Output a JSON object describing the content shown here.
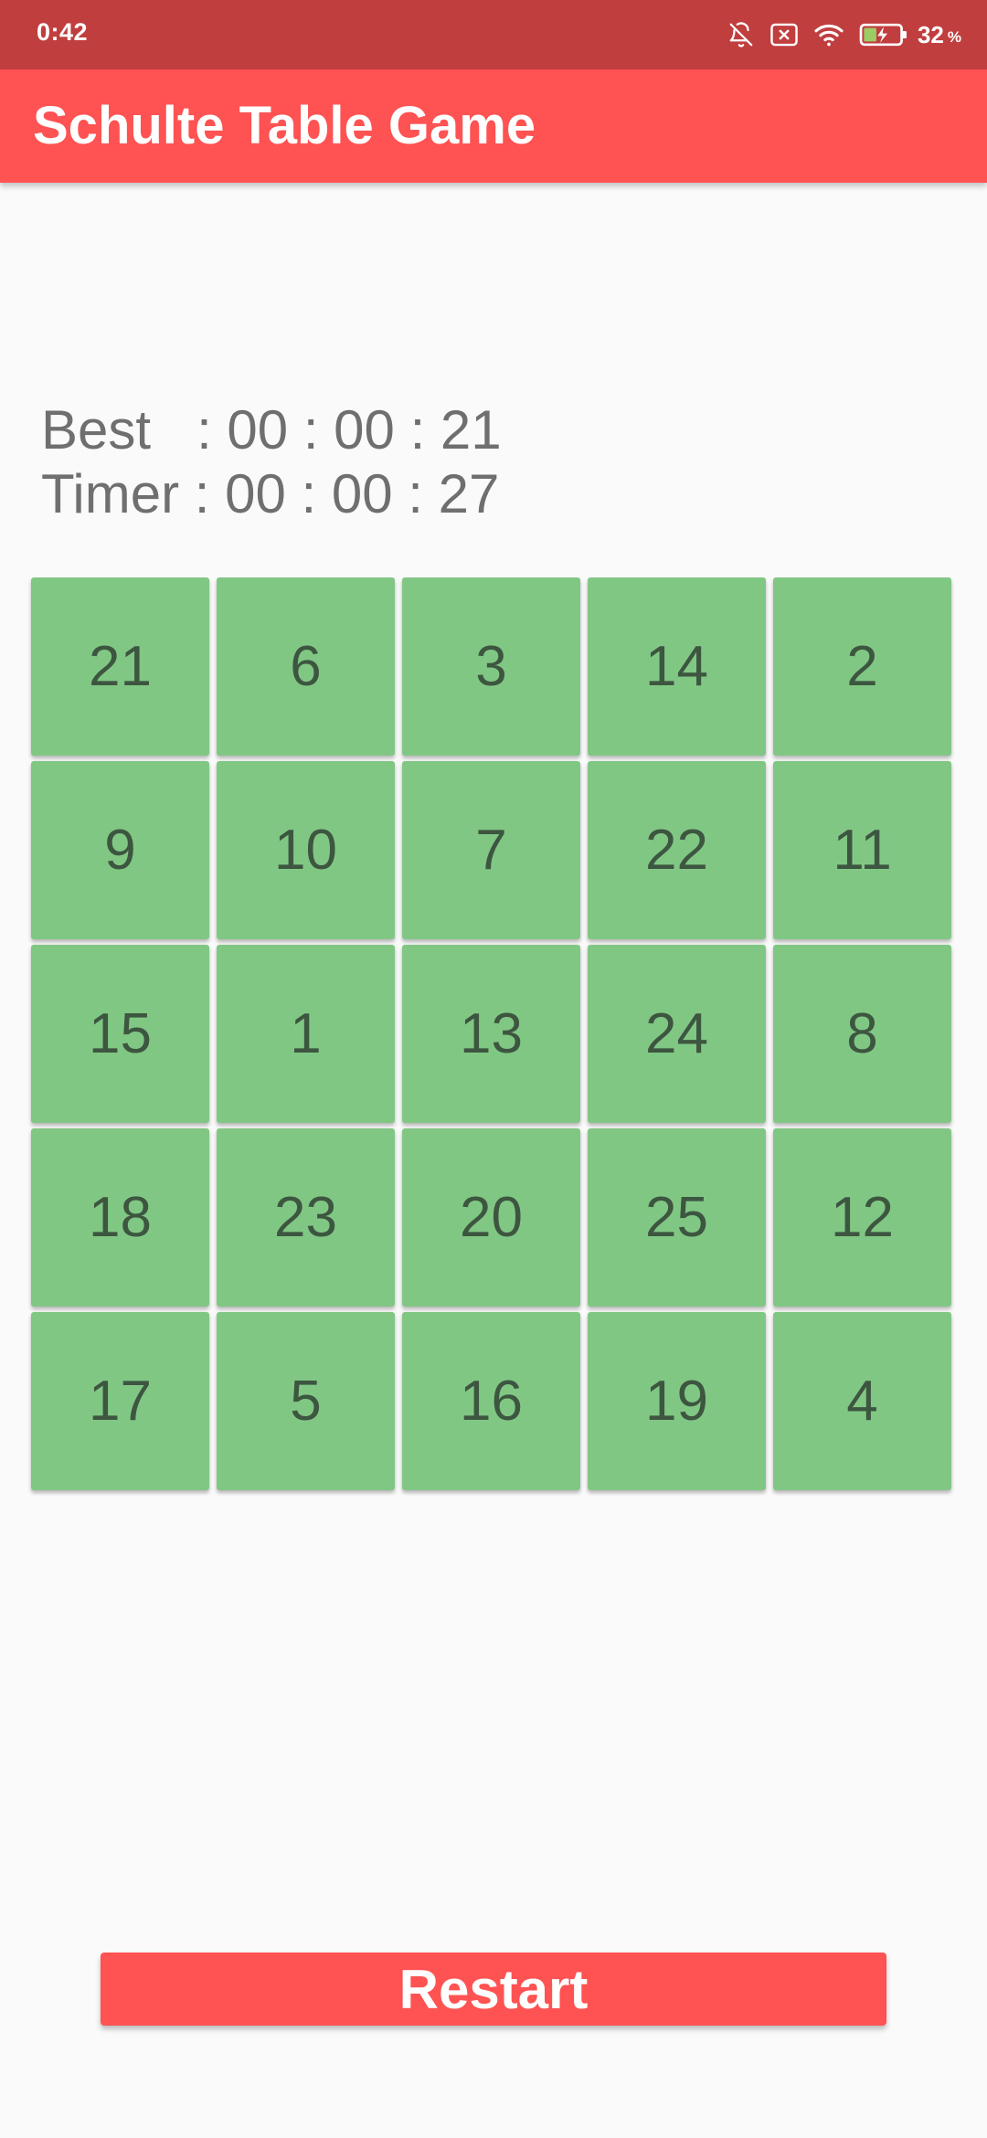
{
  "status_bar": {
    "time": "0:42",
    "battery_percent": "32",
    "battery_unit": "%",
    "icons": [
      "bell-off-icon",
      "notification-close-icon",
      "wifi-icon",
      "battery-charging-icon"
    ]
  },
  "app_bar": {
    "title": "Schulte Table Game"
  },
  "timers": {
    "best": "Best   : 00 : 00 : 21",
    "timer": "Timer : 00 : 00 : 27"
  },
  "grid": {
    "cells": [
      21,
      6,
      3,
      14,
      2,
      9,
      10,
      7,
      22,
      11,
      15,
      1,
      13,
      24,
      8,
      18,
      23,
      20,
      25,
      12,
      17,
      5,
      16,
      19,
      4
    ]
  },
  "restart_label": "Restart",
  "colors": {
    "status_bar": "#c13e3f",
    "app_bar": "#ff5252",
    "cell": "#81c784",
    "cell_text": "#3d5640",
    "button": "#ff5252"
  }
}
